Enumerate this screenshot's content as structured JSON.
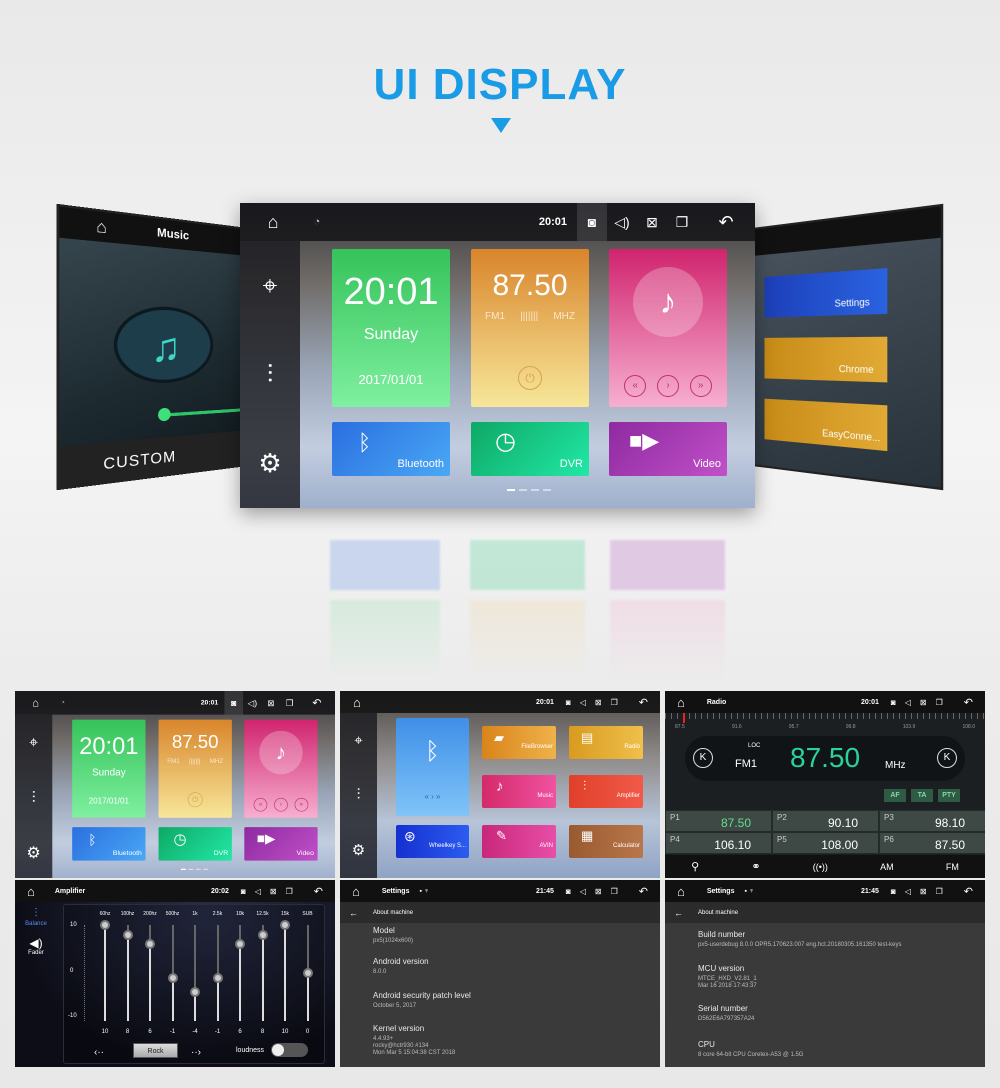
{
  "header": {
    "title": "UI DISPLAY"
  },
  "colors": {
    "accent": "#1a9be6",
    "radio_green": "#2ad39a"
  },
  "status": {
    "time": "20:01",
    "icons": [
      "home-icon",
      "wifi-icon",
      "camera-icon",
      "volume-icon",
      "close-box-icon",
      "windows-icon",
      "back-icon"
    ]
  },
  "left_panel": {
    "title": "Music",
    "mode": "CUSTOM"
  },
  "right_panel": {
    "apps": [
      "Settings",
      "Chrome",
      "EasyConne..."
    ]
  },
  "home": {
    "clock": "20:01",
    "day": "Sunday",
    "date": "2017/01/01",
    "radio_freq": "87.50",
    "band": "FM1",
    "unit": "MHZ",
    "tiles": [
      "Bluetooth",
      "DVR",
      "Video"
    ]
  },
  "apps": {
    "time": "20:01",
    "tiles": [
      "FileBrowser",
      "Radio",
      "Music",
      "Amplifier",
      "Wheelkey S...",
      "AVIN",
      "Calculator"
    ]
  },
  "radio": {
    "title": "Radio",
    "time": "20:01",
    "scale": [
      "87.5",
      "91.6",
      "95.7",
      "99.8",
      "103.9",
      "108.0"
    ],
    "loc": "LOC",
    "band": "FM1",
    "freq": "87.50",
    "unit": "MHz",
    "buttons": [
      "AF",
      "TA",
      "PTY"
    ],
    "presets": [
      {
        "p": "P1",
        "v": "87.50"
      },
      {
        "p": "P2",
        "v": "90.10"
      },
      {
        "p": "P3",
        "v": "98.10"
      },
      {
        "p": "P4",
        "v": "106.10"
      },
      {
        "p": "P5",
        "v": "108.00"
      },
      {
        "p": "P6",
        "v": "87.50"
      }
    ],
    "bottom": {
      "am": "AM",
      "fm": "FM"
    }
  },
  "amplifier": {
    "title": "Amplifier",
    "time": "20:02",
    "tabs": [
      "Balance",
      "Fader"
    ],
    "scale": [
      "10",
      "0",
      "-10"
    ],
    "bands": [
      "60hz",
      "100hz",
      "200hz",
      "500hz",
      "1k",
      "2.5k",
      "10k",
      "12.5k",
      "15k",
      "SUB"
    ],
    "values": [
      10,
      8,
      6,
      -1,
      -4,
      -1,
      6,
      8,
      10,
      0
    ],
    "preset": "Rock",
    "loudness_label": "loudness",
    "loudness_on": false
  },
  "settings1": {
    "title": "Settings",
    "time": "21:45",
    "header": "About machine",
    "items": [
      {
        "k": "Model",
        "v": "px5(1024x600)"
      },
      {
        "k": "Android version",
        "v": "8.0.0"
      },
      {
        "k": "Android security patch level",
        "v": "October 5, 2017"
      },
      {
        "k": "Kernel version",
        "v": "4.4.93+\nrocky@hctr930 #134\nMon Mar 5 15:04:38 CST 2018"
      }
    ]
  },
  "settings2": {
    "title": "Settings",
    "time": "21:45",
    "header": "About machine",
    "items": [
      {
        "k": "Build number",
        "v": "px5-userdebug 8.0.0 OPR5.170623.007 eng.hct.20180305.161350 test-keys"
      },
      {
        "k": "MCU version",
        "v": "MTCE_HXD_V2.81_1\nMar 16 2018 17:43:37"
      },
      {
        "k": "Serial number",
        "v": "D562E6A797357A24"
      },
      {
        "k": "CPU",
        "v": "8 core 64-bit CPU Coretex-A53 @ 1.5G"
      }
    ]
  }
}
